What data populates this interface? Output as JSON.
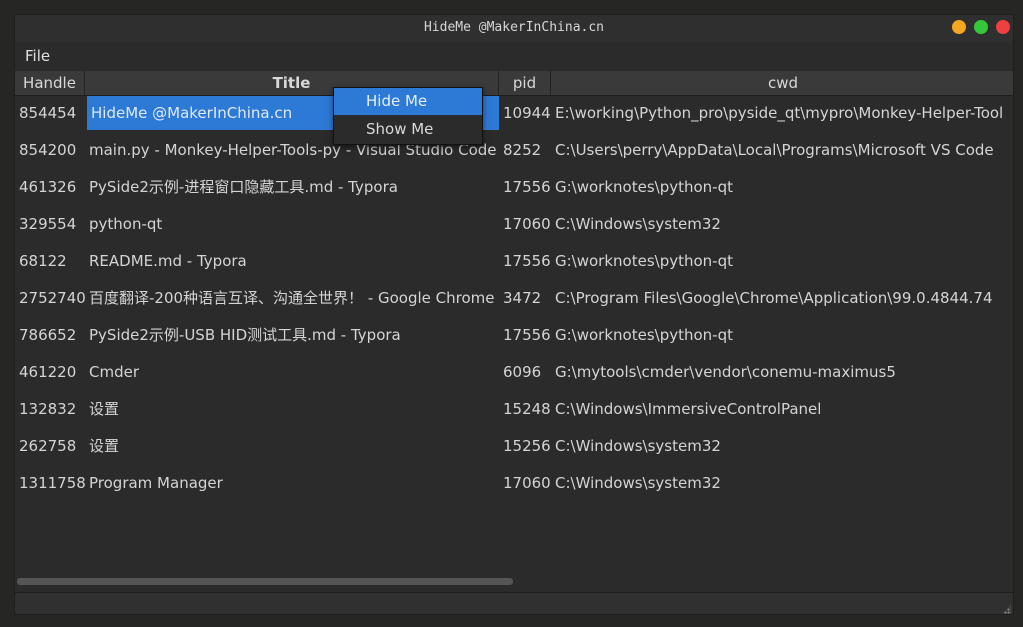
{
  "window": {
    "title": "HideMe @MakerInChina.cn"
  },
  "menubar": {
    "items": [
      "File"
    ]
  },
  "table": {
    "columns": [
      "Handle",
      "Title",
      "pid",
      "cwd"
    ],
    "rows": [
      {
        "handle": "854454",
        "title": "HideMe @MakerInChina.cn",
        "pid": "10944",
        "cwd": "E:\\working\\Python_pro\\pyside_qt\\mypro\\Monkey-Helper-Tool"
      },
      {
        "handle": "854200",
        "title": "main.py - Monkey-Helper-Tools-py - Visual Studio Code",
        "pid": "8252",
        "cwd": "C:\\Users\\perry\\AppData\\Local\\Programs\\Microsoft VS Code"
      },
      {
        "handle": "461326",
        "title": "PySide2示例-进程窗口隐藏工具.md - Typora",
        "pid": "17556",
        "cwd": "G:\\worknotes\\python-qt"
      },
      {
        "handle": "329554",
        "title": "python-qt",
        "pid": "17060",
        "cwd": "C:\\Windows\\system32"
      },
      {
        "handle": "68122",
        "title": "README.md - Typora",
        "pid": "17556",
        "cwd": "G:\\worknotes\\python-qt"
      },
      {
        "handle": "2752740",
        "title": "百度翻译-200种语言互译、沟通全世界！ - Google Chrome",
        "pid": "3472",
        "cwd": "C:\\Program Files\\Google\\Chrome\\Application\\99.0.4844.74"
      },
      {
        "handle": "786652",
        "title": "PySide2示例-USB HID测试工具.md - Typora",
        "pid": "17556",
        "cwd": "G:\\worknotes\\python-qt"
      },
      {
        "handle": "461220",
        "title": "Cmder",
        "pid": "6096",
        "cwd": "G:\\mytools\\cmder\\vendor\\conemu-maximus5"
      },
      {
        "handle": "132832",
        "title": "设置",
        "pid": "15248",
        "cwd": "C:\\Windows\\ImmersiveControlPanel"
      },
      {
        "handle": "262758",
        "title": "设置",
        "pid": "15256",
        "cwd": "C:\\Windows\\system32"
      },
      {
        "handle": "1311758",
        "title": "Program Manager",
        "pid": "17060",
        "cwd": "C:\\Windows\\system32"
      }
    ],
    "selected_row": 0
  },
  "context_menu": {
    "items": [
      "Hide Me",
      "Show Me"
    ],
    "active_index": 0
  },
  "colors": {
    "accent": "#2d7ad6",
    "background": "#2b2b2b",
    "minimize": "#f5a623",
    "maximize": "#35c73a",
    "close": "#ee4040"
  }
}
